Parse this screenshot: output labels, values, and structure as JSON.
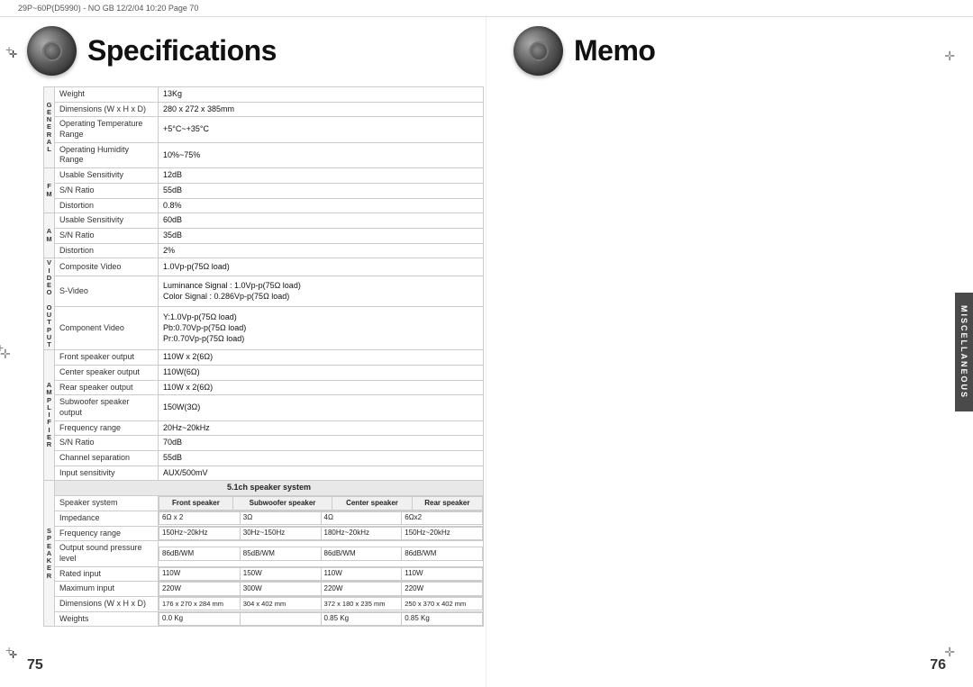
{
  "topbar": {
    "text": "29P~60P(D5990) - NO GB  12/2/04  10:20   Page 70"
  },
  "left_page": {
    "title": "Specifications",
    "page_number": "75",
    "general_label": "G\nE\nN\nE\nR\nA\nL",
    "fm_label": "F\nM",
    "am_label": "A\nM",
    "video_label": "V\nI\nD\nE\nO",
    "amplifier_label": "A\nM\nP\nL\nI\nF\nI\nE\nR",
    "speaker_label": "S\nP\nE\nA\nK\nE\nR",
    "general_rows": [
      {
        "name": "Weight",
        "value": "13Kg"
      },
      {
        "name": "Dimensions (W x H x D)",
        "value": "280 x 272 x 385mm"
      },
      {
        "name": "Operating Temperature Range",
        "value": "+5°C~+35°C"
      },
      {
        "name": "Operating Humidity Range",
        "value": "10%~75%"
      }
    ],
    "fm_rows": [
      {
        "name": "Usable Sensitivity",
        "value": "12dB"
      },
      {
        "name": "S/N Ratio",
        "value": "55dB"
      },
      {
        "name": "Distortion",
        "value": "0.8%"
      }
    ],
    "am_rows": [
      {
        "name": "Usable Sensitivity",
        "value": "60dB"
      },
      {
        "name": "S/N Ratio",
        "value": "35dB"
      },
      {
        "name": "Distortion",
        "value": "2%"
      }
    ],
    "video_rows": [
      {
        "name": "Composite Video",
        "value": "1.0Vp-p(75Ω load)"
      },
      {
        "name": "S-Video",
        "value": "Luminance Signal : 1.0Vp-p(75Ω load)\nColor Signal : 0.286Vp-p(75Ω load)"
      },
      {
        "name": "Component Video",
        "value": "Y:1.0Vp-p(75Ω load)\nPb:0.70Vp-p(75Ω load)\nPr:0.70Vp-p(75Ω load)"
      }
    ],
    "amplifier_rows": [
      {
        "name": "Front speaker output",
        "value": "110W x 2(6Ω)"
      },
      {
        "name": "Center speaker output",
        "value": "110W(6Ω)"
      },
      {
        "name": "Rear speaker output",
        "value": "110W x 2(6Ω)"
      },
      {
        "name": "Subwoofer speaker output",
        "value": "150W(3Ω)"
      },
      {
        "name": "Frequency range",
        "value": "20Hz~20kHz"
      },
      {
        "name": "S/N Ratio",
        "value": "70dB"
      },
      {
        "name": "Channel separation",
        "value": "55dB"
      },
      {
        "name": "Input sensitivity",
        "value": "AUX/500mV"
      }
    ],
    "speaker_section_header": "5.1ch speaker system",
    "speaker_cols": [
      "Front speaker",
      "Subwoofer speaker",
      "Center speaker",
      "Rear speaker"
    ],
    "speaker_rows": [
      {
        "prop": "Speaker system",
        "values": [
          "",
          "",
          "",
          ""
        ]
      },
      {
        "prop": "Impedance",
        "values": [
          "6Ω x 2",
          "3Ω",
          "4Ω",
          "6Ωx2"
        ]
      },
      {
        "prop": "Frequency range",
        "values": [
          "150Hz~20kHz",
          "30Hz~150Hz",
          "180Hz~20kHz",
          "150Hz~20kHz"
        ]
      },
      {
        "prop": "Output sound pressure level",
        "values": [
          "86dB/WM",
          "85dB/WM",
          "86dB/WM",
          "86dB/WM"
        ]
      },
      {
        "prop": "Rated input",
        "values": [
          "110W",
          "150W",
          "110W",
          "110W"
        ]
      },
      {
        "prop": "Maximum input",
        "values": [
          "220W",
          "300W",
          "220W",
          "220W"
        ]
      },
      {
        "prop": "Dimensions (W x H x D)",
        "values": [
          "176 x 270 x 284 mm",
          "304 x 402 mm",
          "372 x 180 x 235 mm",
          "250 x 370 x 402 mm"
        ]
      },
      {
        "prop": "Weights",
        "values": [
          "0.0 Kg",
          "",
          "0.85 Kg",
          "0.85 Kg"
        ]
      }
    ]
  },
  "right_page": {
    "title": "Memo",
    "page_number": "76",
    "misc_label": "MISCELLANEOUS"
  }
}
